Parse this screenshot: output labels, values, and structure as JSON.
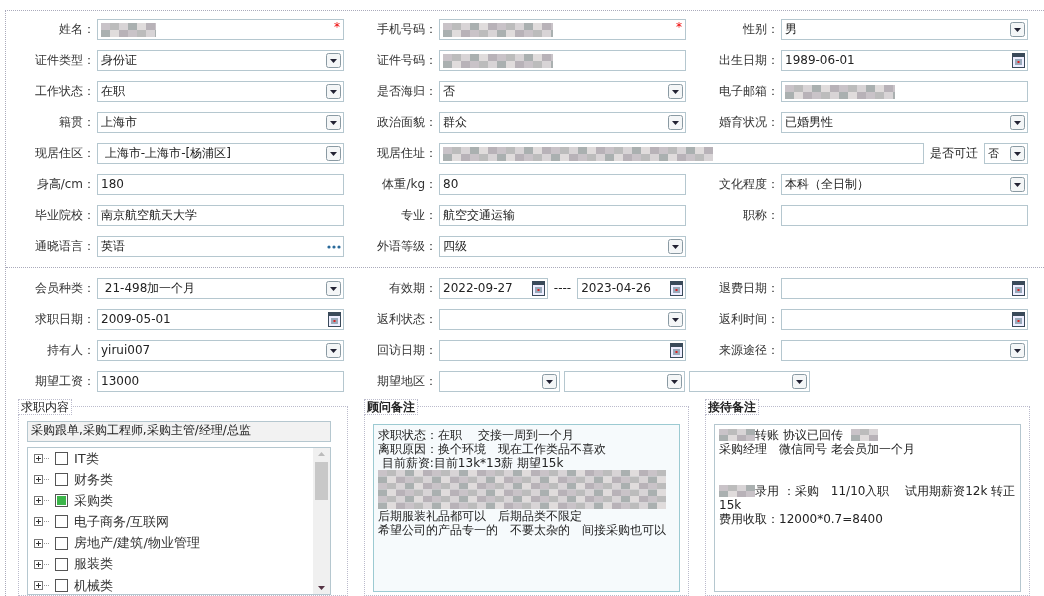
{
  "sections": [
    {
      "rows": [
        [
          {
            "label": "姓名：",
            "controls": [
              {
                "kind": "text",
                "redacted": true,
                "required_mark": "*"
              }
            ]
          },
          {
            "label": "手机号码：",
            "controls": [
              {
                "kind": "text",
                "redacted": true,
                "required_mark": "*"
              }
            ]
          },
          {
            "label": "性别：",
            "controls": [
              {
                "kind": "select",
                "value": "男"
              }
            ]
          }
        ],
        [
          {
            "label": "证件类型：",
            "controls": [
              {
                "kind": "select",
                "value": "身份证"
              }
            ]
          },
          {
            "label": "证件号码：",
            "controls": [
              {
                "kind": "text",
                "redacted": true
              }
            ]
          },
          {
            "label": "出生日期：",
            "controls": [
              {
                "kind": "date",
                "value": "1989-06-01"
              }
            ]
          }
        ],
        [
          {
            "label": "工作状态：",
            "controls": [
              {
                "kind": "select",
                "value": "在职"
              }
            ]
          },
          {
            "label": "是否海归：",
            "controls": [
              {
                "kind": "select",
                "value": "否"
              }
            ]
          },
          {
            "label": "电子邮箱：",
            "controls": [
              {
                "kind": "text",
                "redacted": true
              }
            ]
          }
        ],
        [
          {
            "label": "籍贯：",
            "controls": [
              {
                "kind": "select",
                "value": "上海市"
              }
            ]
          },
          {
            "label": "政治面貌：",
            "controls": [
              {
                "kind": "select",
                "value": "群众"
              }
            ]
          },
          {
            "label": "婚育状况：",
            "controls": [
              {
                "kind": "select",
                "value": "已婚男性"
              }
            ]
          }
        ],
        [
          {
            "label": "现居住区：",
            "controls": [
              {
                "kind": "select",
                "value": " 上海市-上海市-[杨浦区]"
              }
            ]
          },
          {
            "label": "现居住址：",
            "controls": [
              {
                "kind": "text",
                "redacted": true
              },
              {
                "kind": "label",
                "text": "是否可迁"
              },
              {
                "kind": "select",
                "value": "否"
              }
            ]
          }
        ],
        [
          {
            "label": "身高/cm：",
            "controls": [
              {
                "kind": "text",
                "value": "180"
              }
            ]
          },
          {
            "label": "体重/kg：",
            "controls": [
              {
                "kind": "text",
                "value": "80"
              }
            ]
          },
          {
            "label": "文化程度：",
            "controls": [
              {
                "kind": "select",
                "value": "本科（全日制）"
              }
            ]
          }
        ],
        [
          {
            "label": "毕业院校：",
            "controls": [
              {
                "kind": "text",
                "value": "南京航空航天大学"
              }
            ]
          },
          {
            "label": "专业：",
            "controls": [
              {
                "kind": "text",
                "value": "航空交通运输"
              }
            ]
          },
          {
            "label": "职称：",
            "controls": [
              {
                "kind": "text"
              }
            ]
          }
        ],
        [
          {
            "label": "通晓语言：",
            "controls": [
              {
                "kind": "picker",
                "value": "英语"
              }
            ]
          },
          {
            "label": "外语等级：",
            "controls": [
              {
                "kind": "select",
                "value": "四级"
              }
            ]
          },
          null
        ]
      ]
    },
    {
      "rows": [
        [
          {
            "label": "会员种类：",
            "controls": [
              {
                "kind": "select",
                "value": " 21-498加一个月"
              }
            ]
          },
          {
            "label": "有效期：",
            "controls": [
              {
                "kind": "date",
                "value": "2022-09-27"
              },
              {
                "kind": "label",
                "text": "----"
              },
              {
                "kind": "date",
                "value": "2023-04-26"
              }
            ]
          },
          {
            "label": "退费日期：",
            "controls": [
              {
                "kind": "date"
              }
            ]
          }
        ],
        [
          {
            "label": "求职日期：",
            "controls": [
              {
                "kind": "date",
                "value": "2009-05-01"
              }
            ]
          },
          {
            "label": "返利状态：",
            "controls": [
              {
                "kind": "select"
              }
            ]
          },
          {
            "label": "返利时间：",
            "controls": [
              {
                "kind": "date"
              }
            ]
          }
        ],
        [
          {
            "label": "持有人：",
            "controls": [
              {
                "kind": "select",
                "value": "yirui007"
              }
            ]
          },
          {
            "label": "回访日期：",
            "controls": [
              {
                "kind": "date"
              }
            ]
          },
          {
            "label": "来源途径：",
            "controls": [
              {
                "kind": "select"
              }
            ]
          }
        ],
        [
          {
            "label": "期望工资：",
            "controls": [
              {
                "kind": "text",
                "value": "13000"
              }
            ]
          },
          {
            "label": "期望地区：",
            "controls": [
              {
                "kind": "select"
              },
              {
                "kind": "select"
              },
              {
                "kind": "select"
              }
            ]
          }
        ]
      ]
    }
  ],
  "job_intent": {
    "legend": "求职内容",
    "summary": "采购跟单,采购工程师,采购主管/经理/总监",
    "categories": [
      {
        "label": "IT类",
        "checked": false
      },
      {
        "label": "财务类",
        "checked": false
      },
      {
        "label": "采购类",
        "checked": true
      },
      {
        "label": "电子商务/互联网",
        "checked": false
      },
      {
        "label": "房地产/建筑/物业管理",
        "checked": false
      },
      {
        "label": "服装类",
        "checked": false
      },
      {
        "label": "机械类",
        "checked": false
      }
    ]
  },
  "notes": [
    {
      "legend": "顾问备注",
      "lines": [
        {
          "kind": "text",
          "text": "求职状态：在职　 交接一周到一个月"
        },
        {
          "kind": "text",
          "text": "离职原因：换个环境　现在工作类品不喜欢"
        },
        {
          "kind": "text",
          "text": " 目前薪资:目前13k*13薪 期望15k"
        },
        {
          "kind": "blurred"
        },
        {
          "kind": "blurred"
        },
        {
          "kind": "blurred"
        },
        {
          "kind": "text",
          "text": "后期服装礼品都可以　后期品类不限定"
        },
        {
          "kind": "text",
          "text": "希望公司的产品专一的　不要太杂的　间接采购也可以"
        }
      ]
    },
    {
      "legend": "接待备注",
      "lines": [
        {
          "kind": "text",
          "text": "转账 协议已回传",
          "blur_before": true,
          "blur_after": true
        },
        {
          "kind": "text",
          "text": "采购经理　微信同号 老会员加一个月"
        },
        {
          "kind": "gap"
        },
        {
          "kind": "gap"
        },
        {
          "kind": "text",
          "text": "录用 ：采购　11/10入职　 试用期薪资12k 转正",
          "blur_before": true
        },
        {
          "kind": "text",
          "text": "15k"
        },
        {
          "kind": "text",
          "text": "费用收取：12000*0.7=8400"
        }
      ]
    }
  ]
}
